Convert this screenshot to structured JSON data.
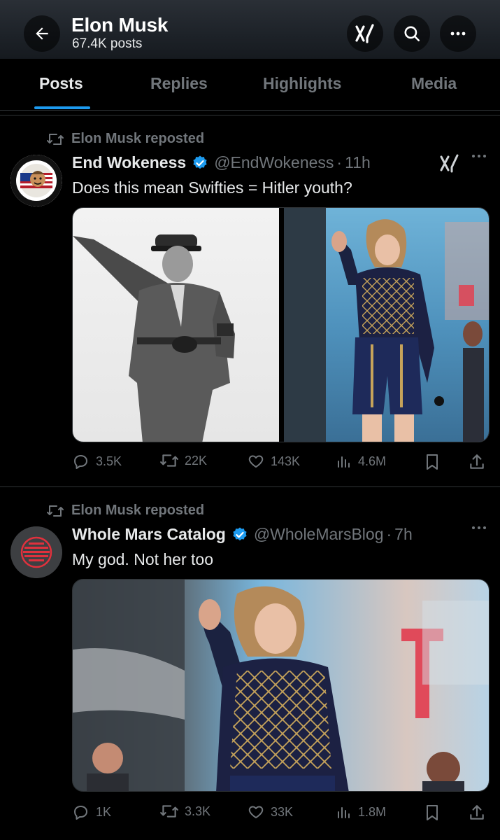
{
  "header": {
    "title": "Elon Musk",
    "subtitle": "67.4K posts",
    "icons": [
      "arrow-left-icon",
      "grok-icon",
      "search-icon",
      "more-icon"
    ]
  },
  "tabs": [
    {
      "label": "Posts",
      "active": true
    },
    {
      "label": "Replies",
      "active": false
    },
    {
      "label": "Highlights",
      "active": false
    },
    {
      "label": "Media",
      "active": false
    }
  ],
  "posts": [
    {
      "repost_label": "Elon Musk reposted",
      "author": "End Wokeness",
      "handle": "@EndWokeness",
      "separator": "·",
      "time": "11h",
      "text": "Does this mean Swifties = Hitler youth?",
      "avatar_text": [
        "I SUPPORT THE",
        "FORMER THING"
      ],
      "stats": {
        "replies": "3.5K",
        "reposts": "22K",
        "likes": "143K",
        "views": "4.6M"
      }
    },
    {
      "repost_label": "Elon Musk reposted",
      "author": "Whole Mars Catalog",
      "handle": "@WholeMarsBlog",
      "separator": "·",
      "time": "7h",
      "text": "My god. Not her too",
      "stats": {
        "replies": "1K",
        "reposts": "3.3K",
        "likes": "33K",
        "views": "1.8M"
      }
    }
  ],
  "colors": {
    "background": "#000000",
    "accent": "#1d9bf0",
    "muted": "#71767b",
    "text": "#e7e9ea"
  }
}
